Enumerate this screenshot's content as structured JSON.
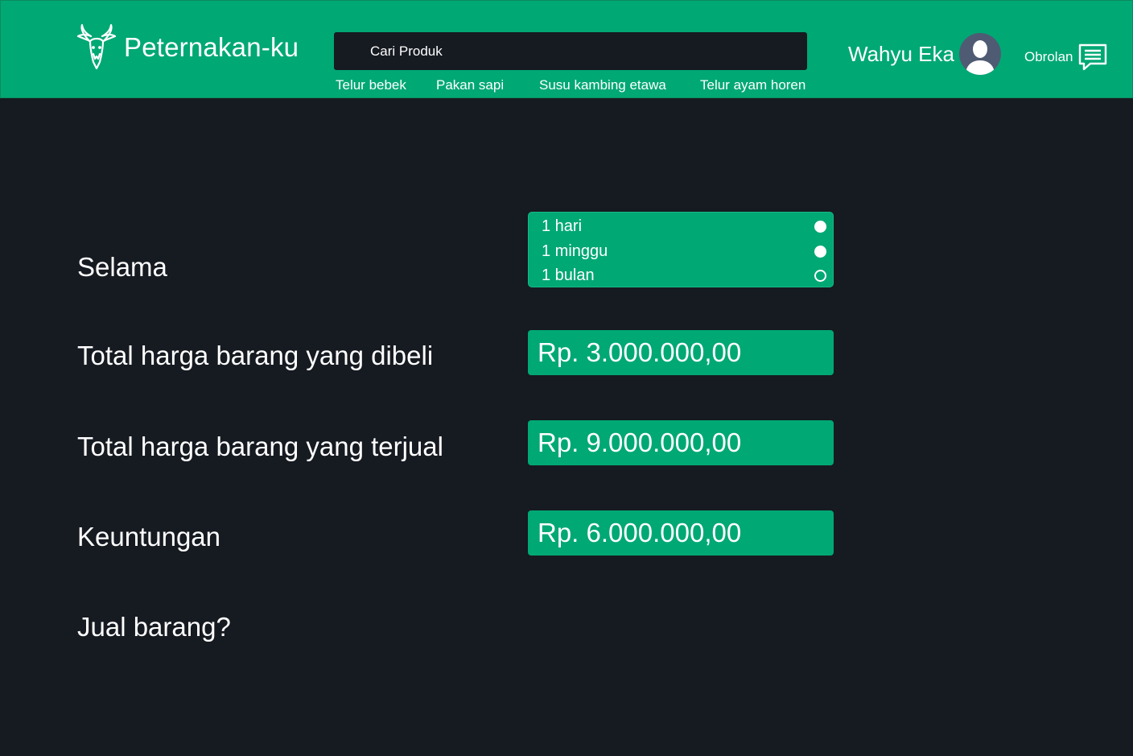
{
  "app": {
    "name": "Peternakan-ku",
    "brand_color": "#00a874",
    "background_color": "#161a21"
  },
  "header": {
    "search": {
      "placeholder": "Cari Produk",
      "value": ""
    },
    "categories": [
      "Telur bebek",
      "Pakan sapi",
      "Susu kambing etawa",
      "Telur ayam horen"
    ],
    "user": {
      "name": "Wahyu Eka",
      "avatar_icon": "user-avatar-icon"
    },
    "chat": {
      "label": "Obrolan",
      "icon": "chat-icon"
    }
  },
  "report": {
    "period_label": "Selama",
    "period_options": [
      {
        "label": "1 hari",
        "state": "filled"
      },
      {
        "label": "1 minggu",
        "state": "filled"
      },
      {
        "label": "1 bulan",
        "state": "empty"
      }
    ],
    "bought_label": "Total harga barang yang dibeli",
    "bought_value": "Rp. 3.000.000,00",
    "sold_label": "Total harga barang yang terjual",
    "sold_value": "Rp. 9.000.000,00",
    "profit_label": "Keuntungan",
    "profit_value": "Rp. 6.000.000,00",
    "sell_question": "Jual barang?"
  }
}
